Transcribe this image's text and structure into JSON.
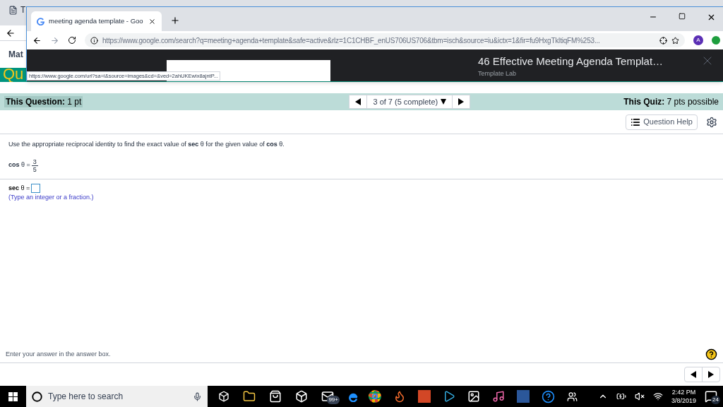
{
  "back_window": {
    "tab_title": "T",
    "bookmark": "Mat",
    "quiz_title": "Qu"
  },
  "question_bar": {
    "question_points": "**This Question:** 1 pt",
    "position": "3 of 7 (5 complete)",
    "quiz_points": "**This Quiz:** 7 pts possible"
  },
  "question_help": "Question Help",
  "question": {
    "prompt": "Use the appropriate reciprocal identity to find the exact value of **sec** θ for the given value of **cos** θ.",
    "given_lhs": "**cos** θ =",
    "given_numerator": "3",
    "given_denominator": "5",
    "answer_label": "**sec** θ =",
    "hint": "(Type an integer or a fraction.)"
  },
  "footer": {
    "instruction": "Enter your answer in the answer box."
  },
  "browser": {
    "tab_title": "meeting agenda template - Goo",
    "url": "https://www.google.com/search?q=meeting+agenda+template&safe=active&rlz=1C1CHBF_enUS706US706&tbm=isch&source=iu&ictx=1&fir=fu9HxgTkltiqFM%253...",
    "avatar": "A",
    "preview_title": "46 Effective Meeting Agenda Templat…",
    "preview_source": "Template Lab",
    "status_url": "https://www.google.com/url?sa=i&source=images&cd=&ved=2ahUKEwix8ajntP..."
  },
  "taskbar": {
    "search_placeholder": "Type here to search",
    "mail_badge": "99+",
    "time": "2:42 PM",
    "date": "3/8/2019",
    "notifications": "24"
  }
}
